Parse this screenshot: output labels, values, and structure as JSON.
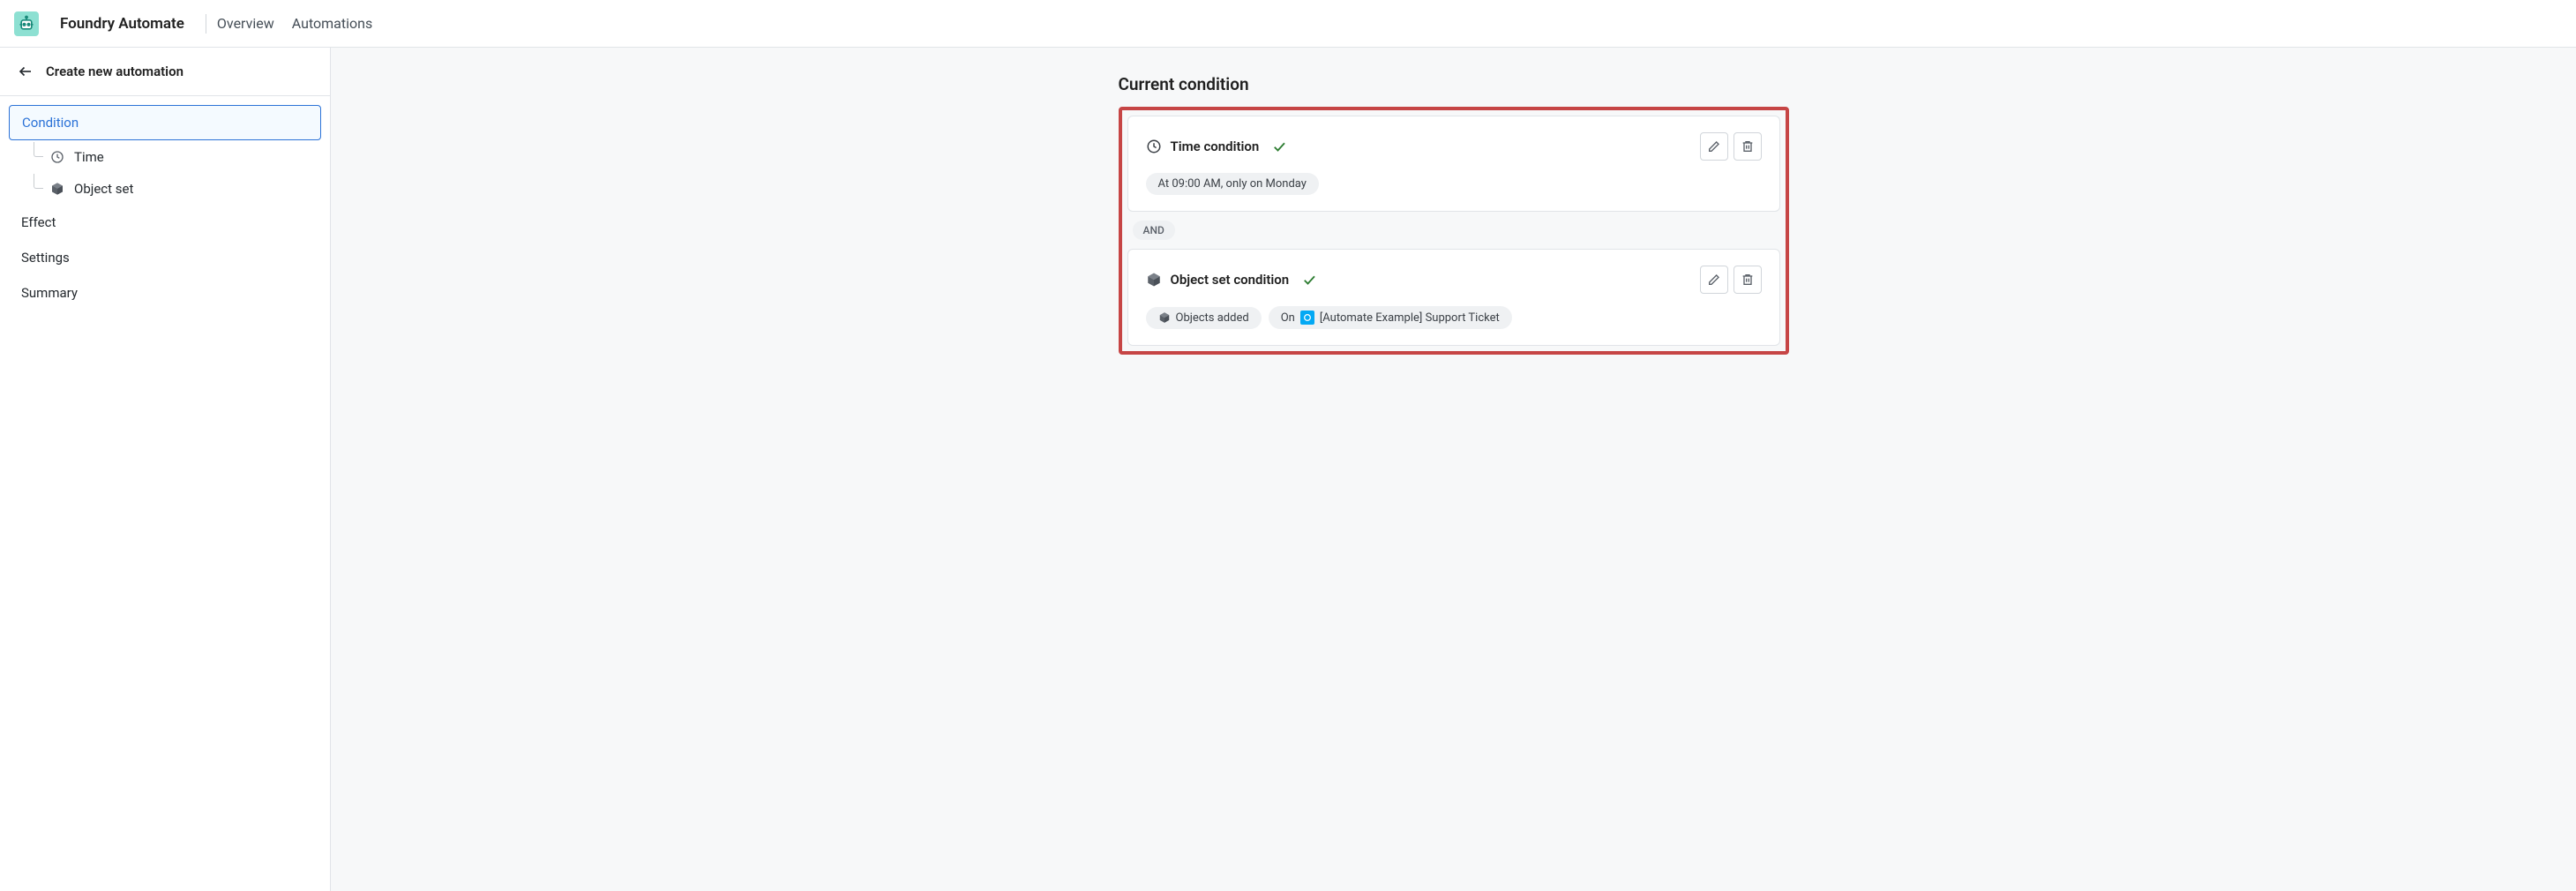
{
  "header": {
    "app_title": "Foundry Automate",
    "nav": {
      "overview": "Overview",
      "automations": "Automations"
    }
  },
  "sidebar": {
    "page_title": "Create new automation",
    "items": {
      "condition": "Condition",
      "effect": "Effect",
      "settings": "Settings",
      "summary": "Summary"
    },
    "subitems": {
      "time": "Time",
      "object_set": "Object set"
    }
  },
  "main": {
    "section_title": "Current condition",
    "connector": "AND",
    "time_condition": {
      "title": "Time condition",
      "schedule_chip": "At 09:00 AM, only on Monday"
    },
    "object_set_condition": {
      "title": "Object set condition",
      "objects_added_chip": "Objects added",
      "on_label": "On",
      "object_type_name": "[Automate Example] Support Ticket"
    }
  }
}
